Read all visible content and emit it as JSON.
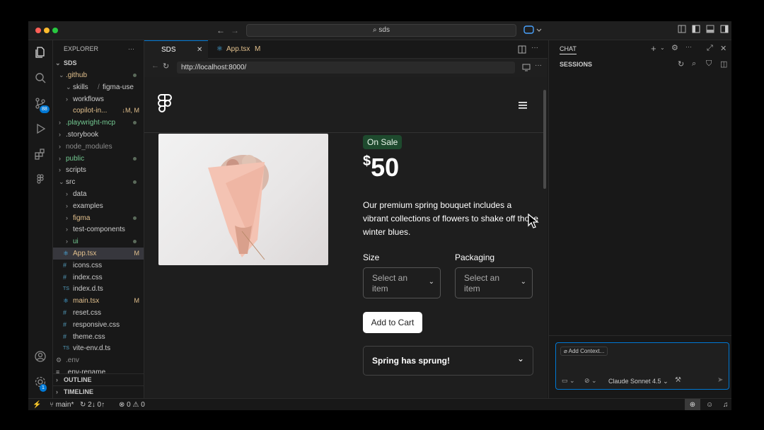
{
  "titlebar": {
    "search_text": "sds",
    "traffic_colors": [
      "#ff5f57",
      "#febc2e",
      "#28c840"
    ]
  },
  "activity_bar": {
    "scm_badge": "88",
    "settings_badge": "1"
  },
  "explorer": {
    "header": "EXPLORER",
    "root": "SDS",
    "items": [
      {
        "label": ".github",
        "depth": 0,
        "type": "folder-open",
        "color": "#e2c08d",
        "dot": true
      },
      {
        "label": "skills",
        "label2": "figma-use",
        "depth": 1,
        "type": "folder-open",
        "color": "#cccccc"
      },
      {
        "label": "workflows",
        "depth": 1,
        "type": "folder",
        "color": "#cccccc"
      },
      {
        "label": "copilot-in...",
        "depth": 1,
        "type": "file",
        "color": "#e2c08d",
        "status": "↓M, M"
      },
      {
        "label": ".playwright-mcp",
        "depth": 0,
        "type": "folder",
        "color": "#73c991",
        "dot": true
      },
      {
        "label": ".storybook",
        "depth": 0,
        "type": "folder",
        "color": "#cccccc"
      },
      {
        "label": "node_modules",
        "depth": 0,
        "type": "folder",
        "color": "#8c8c8c"
      },
      {
        "label": "public",
        "depth": 0,
        "type": "folder",
        "color": "#73c991",
        "dot": true
      },
      {
        "label": "scripts",
        "depth": 0,
        "type": "folder",
        "color": "#cccccc"
      },
      {
        "label": "src",
        "depth": 0,
        "type": "folder-open",
        "color": "#cccccc",
        "dot": true
      },
      {
        "label": "data",
        "depth": 1,
        "type": "folder",
        "color": "#cccccc"
      },
      {
        "label": "examples",
        "depth": 1,
        "type": "folder",
        "color": "#cccccc"
      },
      {
        "label": "figma",
        "depth": 1,
        "type": "folder",
        "color": "#e2c08d",
        "dot": true
      },
      {
        "label": "test-components",
        "depth": 1,
        "type": "folder",
        "color": "#cccccc"
      },
      {
        "label": "ui",
        "depth": 1,
        "type": "folder",
        "color": "#73c991",
        "dot": true
      },
      {
        "label": "App.tsx",
        "depth": 1,
        "type": "react",
        "color": "#e2c08d",
        "status": "M",
        "selected": true
      },
      {
        "label": "icons.css",
        "depth": 1,
        "type": "css",
        "color": "#cccccc"
      },
      {
        "label": "index.css",
        "depth": 1,
        "type": "css",
        "color": "#cccccc"
      },
      {
        "label": "index.d.ts",
        "depth": 1,
        "type": "ts",
        "color": "#cccccc"
      },
      {
        "label": "main.tsx",
        "depth": 1,
        "type": "react",
        "color": "#e2c08d",
        "status": "M"
      },
      {
        "label": "reset.css",
        "depth": 1,
        "type": "css",
        "color": "#cccccc"
      },
      {
        "label": "responsive.css",
        "depth": 1,
        "type": "css",
        "color": "#cccccc"
      },
      {
        "label": "theme.css",
        "depth": 1,
        "type": "css",
        "color": "#cccccc"
      },
      {
        "label": "vite-env.d.ts",
        "depth": 1,
        "type": "ts",
        "color": "#cccccc"
      },
      {
        "label": ".env",
        "depth": 0,
        "type": "gear",
        "color": "#8c8c8c"
      },
      {
        "label": ".env-rename",
        "depth": 0,
        "type": "lines",
        "color": "#cccccc"
      }
    ],
    "outline": "OUTLINE",
    "timeline": "TIMELINE"
  },
  "editor": {
    "tabs": [
      {
        "label": "SDS",
        "active": true
      },
      {
        "label": "App.tsx",
        "status": "M"
      }
    ],
    "url": "http://localhost:8000/"
  },
  "product": {
    "badge": "On Sale",
    "currency": "$",
    "price": "50",
    "description": "Our premium spring bouquet includes a vibrant collections of flowers to shake off those winter blues.",
    "size_label": "Size",
    "size_placeholder": "Select an item",
    "packaging_label": "Packaging",
    "packaging_placeholder": "Select an item",
    "add_to_cart": "Add to Cart",
    "accordion_title": "Spring has sprung!"
  },
  "chat": {
    "title": "CHAT",
    "sessions": "SESSIONS",
    "add_context": "Add Context...",
    "model": "Claude Sonnet 4.5"
  },
  "statusbar": {
    "branch": "main*",
    "sync": "2↓ 0↑",
    "errors": "0",
    "warnings": "0"
  }
}
